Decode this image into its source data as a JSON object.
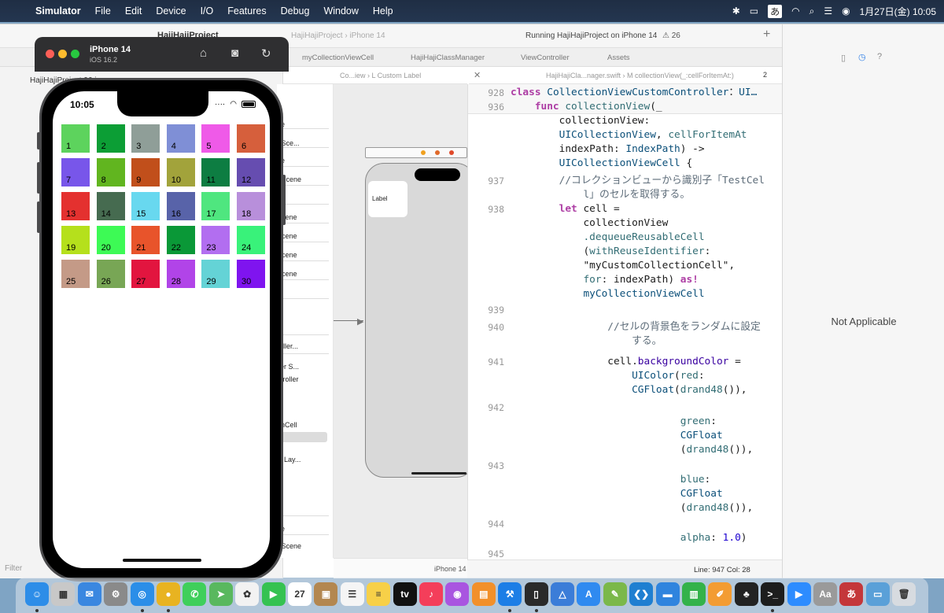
{
  "menubar": {
    "app": "Simulator",
    "items": [
      "File",
      "Edit",
      "Device",
      "I/O",
      "Features",
      "Debug",
      "Window",
      "Help"
    ],
    "input_method": "あ",
    "clock": "1月27日(金)  10:05"
  },
  "xcode": {
    "project": "HajiHajiProject",
    "status": "Running HajiHajiProject on iPhone 14",
    "warnings": "26",
    "tabs": [
      "myCollectionViewCell",
      "HajiHajiClassManager",
      "ViewController",
      "Assets"
    ],
    "scheme_breadcrumb": "HajiHajiProject  ›  iPhone 14",
    "jumpbar_left": "Co...iew  ›  L  Custom Label",
    "jumpbar_right": "HajiHajiCla...nager.swift  ›  M  collectionView(_:cellForItemAt:)",
    "page_count": "2",
    "navigator_root": "HajiHajiProject 96 issues",
    "filter_placeholder": "Filter",
    "outline_rows": [
      "ne",
      "r Sce...",
      "ne",
      "r Scene",
      "e",
      "Scene",
      "Scene",
      "Scene",
      "Scene",
      "roller...",
      "ller S...",
      "ntroller",
      "onCell",
      "el",
      "w Lay...",
      "ne",
      "r Scene"
    ],
    "scene_cell_label": "Label",
    "canvas_device": "iPhone 14",
    "status_line": "Line: 947  Col: 28",
    "inspector_text": "Not Applicable"
  },
  "code": {
    "lines": [
      {
        "num": "928",
        "parts": [
          [
            "kw",
            "class "
          ],
          [
            "ty",
            "CollectionViewCustomController"
          ],
          [
            "",
            "："
          ],
          [
            "ty",
            "UI…"
          ]
        ]
      },
      {
        "num": "936",
        "parts": [
          [
            "kw",
            "    func "
          ],
          [
            "fn",
            "collectionView"
          ],
          [
            "",
            "(_"
          ]
        ]
      },
      {
        "num": "",
        "parts": [
          [
            "",
            "        collectionView:"
          ]
        ]
      },
      {
        "num": "",
        "parts": [
          [
            "ty",
            "        UICollectionView"
          ],
          [
            "",
            ", "
          ],
          [
            "fn",
            "cellForItemAt"
          ]
        ]
      },
      {
        "num": "",
        "parts": [
          [
            "",
            "        indexPath: "
          ],
          [
            "ty",
            "IndexPath"
          ],
          [
            "",
            ") ->"
          ]
        ]
      },
      {
        "num": "",
        "parts": [
          [
            "ty",
            "        UICollectionViewCell"
          ],
          [
            "",
            " {"
          ]
        ]
      },
      {
        "num": "937",
        "parts": [
          [
            "cm",
            "        //コレクションビューから識別子「TestCel"
          ]
        ]
      },
      {
        "num": "",
        "parts": [
          [
            "cm",
            "            l」のセルを取得する。"
          ]
        ]
      },
      {
        "num": "938",
        "parts": [
          [
            "kw",
            "        let "
          ],
          [
            "",
            "cell ="
          ]
        ]
      },
      {
        "num": "",
        "parts": [
          [
            "",
            "            collectionView"
          ]
        ]
      },
      {
        "num": "",
        "parts": [
          [
            "fn",
            "            .dequeueReusableCell"
          ]
        ]
      },
      {
        "num": "",
        "parts": [
          [
            "",
            "            ("
          ],
          [
            "fn",
            "withReuseIdentifier"
          ],
          [
            "",
            ":"
          ]
        ]
      },
      {
        "num": "",
        "parts": [
          [
            "",
            "            \"myCustomCollectionCell\","
          ]
        ]
      },
      {
        "num": "",
        "parts": [
          [
            "fn",
            "            for"
          ],
          [
            "",
            ": indexPath) "
          ],
          [
            "kw",
            "as!"
          ]
        ]
      },
      {
        "num": "",
        "parts": [
          [
            "ty",
            "            myCollectionViewCell"
          ]
        ]
      },
      {
        "num": "939",
        "parts": [
          [
            "",
            ""
          ]
        ]
      },
      {
        "num": "940",
        "parts": [
          [
            "cm",
            "                //セルの背景色をランダムに設定"
          ]
        ]
      },
      {
        "num": "",
        "parts": [
          [
            "cm",
            "                    する。"
          ]
        ]
      },
      {
        "num": "941",
        "parts": [
          [
            "",
            "                cell."
          ],
          [
            "vr",
            "backgroundColor"
          ],
          [
            "",
            " ="
          ]
        ]
      },
      {
        "num": "",
        "parts": [
          [
            "ty",
            "                    UIColor"
          ],
          [
            "",
            "("
          ],
          [
            "fn",
            "red"
          ],
          [
            "",
            ":"
          ]
        ]
      },
      {
        "num": "",
        "parts": [
          [
            "ty",
            "                    CGFloat"
          ],
          [
            "",
            "("
          ],
          [
            "fn",
            "drand48"
          ],
          [
            "",
            "()),"
          ]
        ]
      },
      {
        "num": "942",
        "parts": [
          [
            "",
            ""
          ]
        ]
      },
      {
        "num": "",
        "parts": [
          [
            "fn",
            "                            green"
          ],
          [
            "",
            ":"
          ]
        ]
      },
      {
        "num": "",
        "parts": [
          [
            "ty",
            "                            CGFloat"
          ]
        ]
      },
      {
        "num": "",
        "parts": [
          [
            "",
            "                            ("
          ],
          [
            "fn",
            "drand48"
          ],
          [
            "",
            "()),"
          ]
        ]
      },
      {
        "num": "943",
        "parts": [
          [
            "",
            ""
          ]
        ]
      },
      {
        "num": "",
        "parts": [
          [
            "fn",
            "                            blue"
          ],
          [
            "",
            ":"
          ]
        ]
      },
      {
        "num": "",
        "parts": [
          [
            "ty",
            "                            CGFloat"
          ]
        ]
      },
      {
        "num": "",
        "parts": [
          [
            "",
            "                            ("
          ],
          [
            "fn",
            "drand48"
          ],
          [
            "",
            "()),"
          ]
        ]
      },
      {
        "num": "944",
        "parts": [
          [
            "",
            ""
          ]
        ]
      },
      {
        "num": "",
        "parts": [
          [
            "fn",
            "                            alpha"
          ],
          [
            "",
            ": "
          ],
          [
            "nm",
            "1.0"
          ],
          [
            "",
            ")"
          ]
        ]
      },
      {
        "num": "945",
        "parts": [
          [
            "",
            ""
          ]
        ]
      }
    ]
  },
  "simulator": {
    "device": "iPhone 14",
    "os": "iOS 16.2",
    "time": "10:05",
    "cells": [
      {
        "label": "1",
        "color": "#5dd35d"
      },
      {
        "label": "2",
        "color": "#0c9e35"
      },
      {
        "label": "3",
        "color": "#8f9e98"
      },
      {
        "label": "4",
        "color": "#7f8fd6"
      },
      {
        "label": "5",
        "color": "#ef5ae8"
      },
      {
        "label": "6",
        "color": "#d65f3c"
      },
      {
        "label": "7",
        "color": "#7856ea"
      },
      {
        "label": "8",
        "color": "#61b51f"
      },
      {
        "label": "9",
        "color": "#c14f1b"
      },
      {
        "label": "10",
        "color": "#a2a33b"
      },
      {
        "label": "11",
        "color": "#0d7d42"
      },
      {
        "label": "12",
        "color": "#664db0"
      },
      {
        "label": "13",
        "color": "#e4312f"
      },
      {
        "label": "14",
        "color": "#466b50"
      },
      {
        "label": "15",
        "color": "#68d8ef"
      },
      {
        "label": "16",
        "color": "#5863a9"
      },
      {
        "label": "17",
        "color": "#4fe67f"
      },
      {
        "label": "18",
        "color": "#b88fdb"
      },
      {
        "label": "19",
        "color": "#b5e01c"
      },
      {
        "label": "20",
        "color": "#3dfa55"
      },
      {
        "label": "21",
        "color": "#e8542b"
      },
      {
        "label": "22",
        "color": "#0a9837"
      },
      {
        "label": "23",
        "color": "#b26ef0"
      },
      {
        "label": "24",
        "color": "#39f27a"
      },
      {
        "label": "25",
        "color": "#c49a87"
      },
      {
        "label": "26",
        "color": "#78a655"
      },
      {
        "label": "27",
        "color": "#e2153f"
      },
      {
        "label": "28",
        "color": "#b144e8"
      },
      {
        "label": "29",
        "color": "#64d3d6"
      },
      {
        "label": "30",
        "color": "#7f14ef"
      }
    ]
  },
  "dock": {
    "calendar_day": "27",
    "apps": [
      {
        "name": "finder-icon",
        "color": "#2d8de8",
        "glyph": "☺"
      },
      {
        "name": "launchpad-icon",
        "color": "#c8c8c8",
        "glyph": "▦"
      },
      {
        "name": "mail-icon",
        "color": "#3a87e0",
        "glyph": "✉"
      },
      {
        "name": "system-settings-icon",
        "color": "#8a8a8a",
        "glyph": "⚙"
      },
      {
        "name": "safari-icon",
        "color": "#2b8ee8",
        "glyph": "◎"
      },
      {
        "name": "chrome-icon",
        "color": "#e8b321",
        "glyph": "●"
      },
      {
        "name": "messages-icon",
        "color": "#3fcf5b",
        "glyph": "✆"
      },
      {
        "name": "maps-icon",
        "color": "#59b85e",
        "glyph": "➤"
      },
      {
        "name": "photos-icon",
        "color": "#f2f2f2",
        "glyph": "✿"
      },
      {
        "name": "facetime-icon",
        "color": "#35c251",
        "glyph": "▶"
      },
      {
        "name": "calendar-icon",
        "color": "#ffffff",
        "glyph": "27"
      },
      {
        "name": "notes-folder-icon",
        "color": "#b38750",
        "glyph": "▣"
      },
      {
        "name": "reminders-icon",
        "color": "#f5f5f5",
        "glyph": "☰"
      },
      {
        "name": "notes-icon",
        "color": "#f7d048",
        "glyph": "≡"
      },
      {
        "name": "apple-tv-icon",
        "color": "#111111",
        "glyph": "tv"
      },
      {
        "name": "music-icon",
        "color": "#f43e5a",
        "glyph": "♪"
      },
      {
        "name": "podcasts-icon",
        "color": "#a955e0",
        "glyph": "◉"
      },
      {
        "name": "books-icon",
        "color": "#f2902a",
        "glyph": "▤"
      },
      {
        "name": "xcode-icon",
        "color": "#1c7ee6",
        "glyph": "⚒"
      },
      {
        "name": "simulator-icon",
        "color": "#2a2a2a",
        "glyph": "▯"
      },
      {
        "name": "instruments-icon",
        "color": "#3b7dd8",
        "glyph": "△"
      },
      {
        "name": "app-store-icon",
        "color": "#2f8af0",
        "glyph": "A"
      },
      {
        "name": "script-editor-icon",
        "color": "#7bb84a",
        "glyph": "✎"
      },
      {
        "name": "vscode-icon",
        "color": "#1f7fd1",
        "glyph": "❮❯"
      },
      {
        "name": "keynote-icon",
        "color": "#2f84de",
        "glyph": "▬"
      },
      {
        "name": "numbers-icon",
        "color": "#34b24a",
        "glyph": "▥"
      },
      {
        "name": "pages-icon",
        "color": "#f39c32",
        "glyph": "✐"
      },
      {
        "name": "clipboard-icon",
        "color": "#222222",
        "glyph": "♣"
      },
      {
        "name": "terminal-icon",
        "color": "#1d1d1d",
        "glyph": ">_"
      },
      {
        "name": "zoom-icon",
        "color": "#2d8cff",
        "glyph": "▶"
      },
      {
        "name": "dictionary-icon",
        "color": "#9a9a9a",
        "glyph": "Aa"
      },
      {
        "name": "japanese-input-icon",
        "color": "#c4373a",
        "glyph": "あ"
      },
      {
        "name": "preview-icon",
        "color": "#5aa0d8",
        "glyph": "▭"
      },
      {
        "name": "trash-icon",
        "color": "#d7dbe0",
        "glyph": "🗑"
      }
    ]
  }
}
